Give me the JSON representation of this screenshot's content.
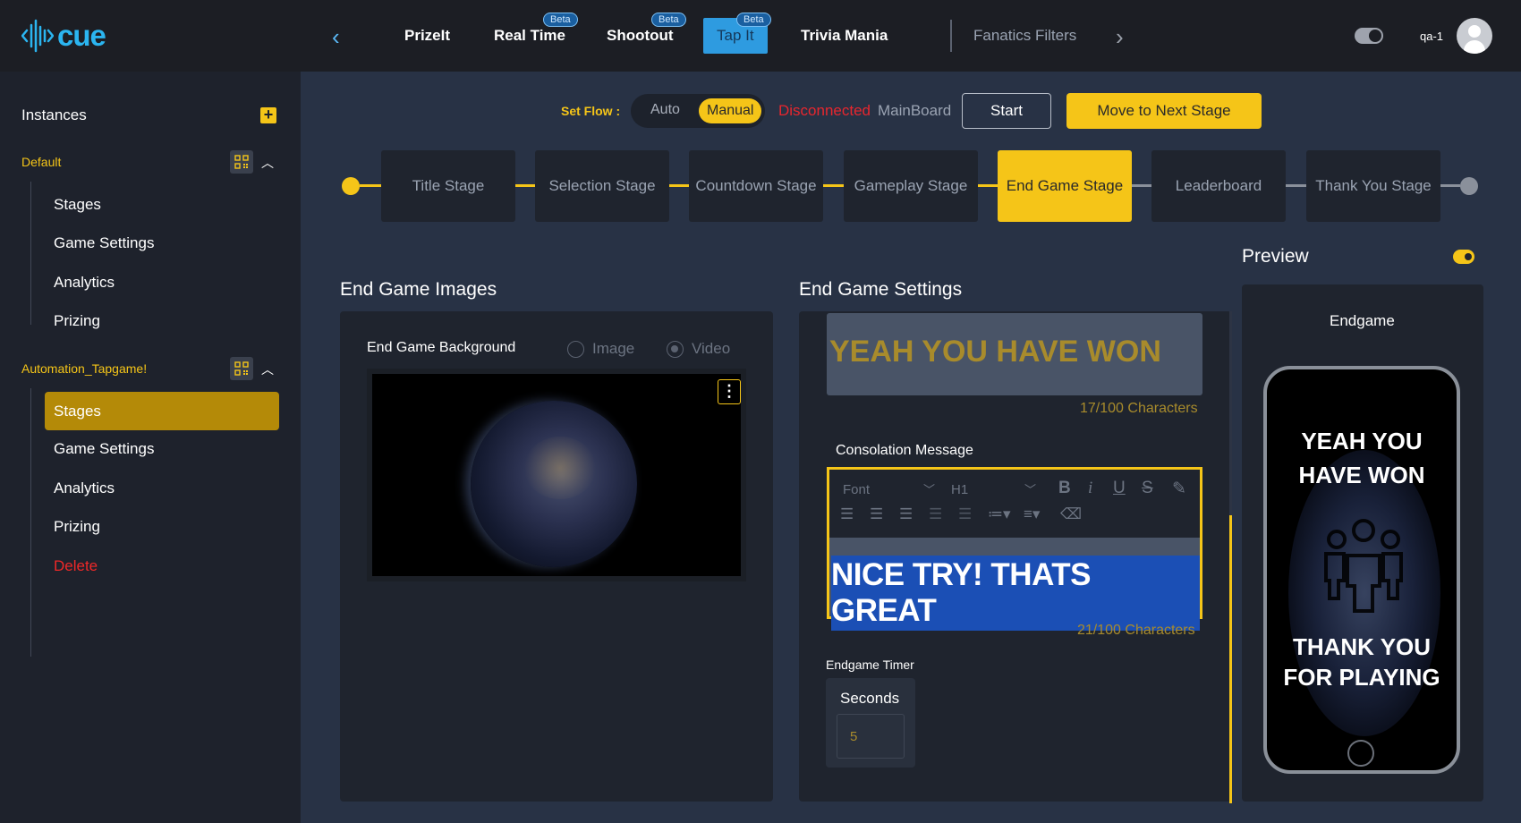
{
  "app": {
    "logo_text": "cue"
  },
  "topnav": {
    "tabs": [
      {
        "label": "PrizeIt",
        "beta": ""
      },
      {
        "label": "Real Time",
        "beta": "Beta"
      },
      {
        "label": "Shootout",
        "beta": "Beta"
      },
      {
        "label": "Tap It",
        "beta": "Beta",
        "active": true
      },
      {
        "label": "Trivia Mania",
        "beta": ""
      },
      {
        "label": "Fanatics Filters",
        "beta": ""
      }
    ],
    "user": "qa-1"
  },
  "sidebar": {
    "title": "Instances",
    "groups": [
      {
        "label": "Default",
        "items": [
          "Stages",
          "Game Settings",
          "Analytics",
          "Prizing"
        ]
      },
      {
        "label": "Automation_Tapgame!",
        "items": [
          "Stages",
          "Game Settings",
          "Analytics",
          "Prizing",
          "Delete"
        ],
        "active_item": "Stages"
      }
    ]
  },
  "flow": {
    "set_flow_label": "Set Flow :",
    "auto": "Auto",
    "manual": "Manual",
    "status": "Disconnected",
    "board": "MainBoard",
    "start": "Start",
    "next": "Move to Next Stage"
  },
  "stages": [
    "Title Stage",
    "Selection Stage",
    "Countdown Stage",
    "Gameplay Stage",
    "End Game Stage",
    "Leaderboard",
    "Thank You Stage"
  ],
  "active_stage": "End Game Stage",
  "images_panel": {
    "title": "End Game Images",
    "bg_label": "End Game Background",
    "opt_image": "Image",
    "opt_video": "Video",
    "kebab": "⋮"
  },
  "settings_panel": {
    "title": "End Game Settings",
    "title_value": "YEAH YOU HAVE WON",
    "title_count": "17/100 Characters",
    "consolation_label": "Consolation Message",
    "font_placeholder": "Font",
    "heading_value": "H1",
    "consolation_value": "NICE TRY! THATS GREAT",
    "consolation_count": "21/100 Characters",
    "timer_label": "Endgame Timer",
    "seconds_label": "Seconds",
    "seconds_value": "5"
  },
  "preview": {
    "title": "Preview",
    "screen_label": "Endgame",
    "line1a": "YEAH YOU",
    "line1b": "HAVE WON",
    "line2a": "THANK YOU",
    "line2b": "FOR PLAYING"
  },
  "colors": {
    "accent": "#f5c518",
    "danger": "#e8262e",
    "brand": "#2bb5f0",
    "bg": "#283245"
  }
}
